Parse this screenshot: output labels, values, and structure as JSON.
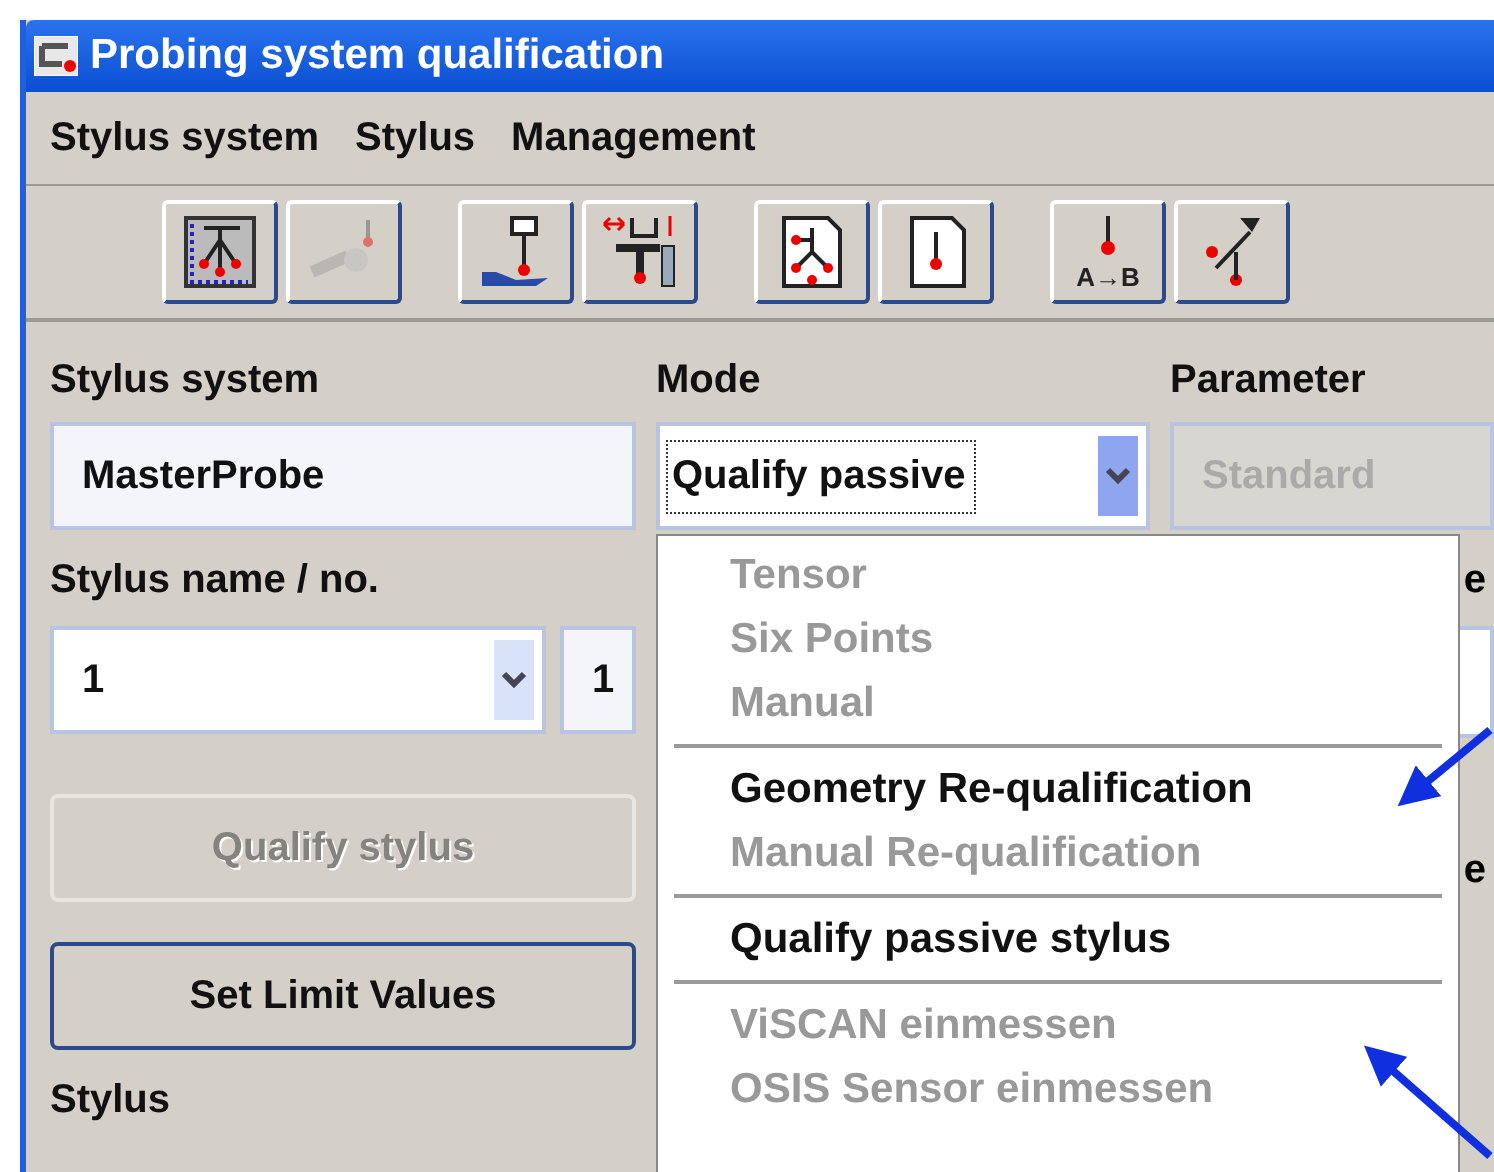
{
  "window": {
    "title": "Probing system qualification"
  },
  "menu": [
    "Stylus system",
    "Stylus",
    "Management"
  ],
  "toolbar": [
    [
      {
        "disabled": false
      },
      {
        "disabled": true
      }
    ],
    [
      {
        "disabled": false
      },
      {
        "disabled": false
      }
    ],
    [
      {
        "disabled": false
      },
      {
        "disabled": false
      }
    ],
    [
      {
        "disabled": false,
        "text": "A→B"
      },
      {
        "disabled": false
      }
    ]
  ],
  "stylus_system": {
    "label": "Stylus system",
    "value": "MasterProbe"
  },
  "mode": {
    "label": "Mode",
    "value": "Qualify passive",
    "expanded": true,
    "option_groups": [
      [
        {
          "label": "Tensor",
          "disabled": true
        },
        {
          "label": "Six Points",
          "disabled": true
        },
        {
          "label": "Manual",
          "disabled": true
        }
      ],
      [
        {
          "label": "Geometry Re-qualification",
          "disabled": false
        },
        {
          "label": "Manual Re-qualification",
          "disabled": true
        }
      ],
      [
        {
          "label": "Qualify passive stylus",
          "disabled": false
        }
      ],
      [
        {
          "label": "ViSCAN einmessen",
          "disabled": true
        },
        {
          "label": "OSIS Sensor einmessen",
          "disabled": true
        }
      ]
    ]
  },
  "parameter": {
    "label": "Parameter",
    "value": "Standard",
    "disabled": true
  },
  "stylus_name": {
    "label": "Stylus name / no.",
    "value": "1",
    "number": "1"
  },
  "buttons": [
    {
      "label": "Qualify stylus",
      "disabled": true
    },
    {
      "label": "Set Limit Values",
      "disabled": false
    }
  ],
  "right_labels": [
    "e",
    "e"
  ],
  "stylus_label": "Stylus"
}
